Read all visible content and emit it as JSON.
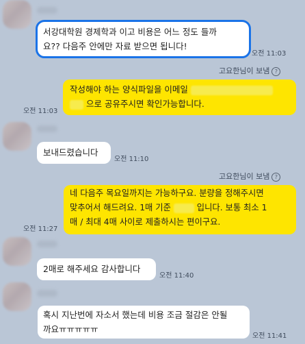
{
  "messages": {
    "m1": {
      "line1": "서강대학원 경제학과 이고 비용은 어느 정도 들까",
      "line2": "요?? 다음주 안에만 자료 받으면 됩니다!",
      "time": "오전 11:03"
    },
    "sender1": "고요한님이 보냄",
    "m2": {
      "line1": "작성해야 하는 양식파일을 이메일",
      "line2": "으로 공유주시면 확인가능합니다.",
      "time": "오전 11:03"
    },
    "m3": {
      "text": "보내드렸습니다",
      "time": "오전 11:10"
    },
    "sender2": "고요한님이 보냄",
    "m4": {
      "line1a": "네 다음주 목요일까지는 가능하구요. 분량을 정해주시면",
      "line2a": "맞추어서 해드려요. 1매 기준",
      "line2b": "입니다. 보통 최소 1",
      "line3": "매 / 최대 4매 사이로 제출하시는 편이구요.",
      "time": "오전 11:27"
    },
    "m5": {
      "text": "2매로 해주세요 감사합니다",
      "time": "오전 11:40"
    },
    "m6": {
      "line1": "혹시 지난번에 자소서 했는데 비용 조금 절감은 안될",
      "line2": "까요ㅠㅠㅠㅠㅠ",
      "time": "오전 11:41"
    },
    "info_glyph": "?"
  }
}
